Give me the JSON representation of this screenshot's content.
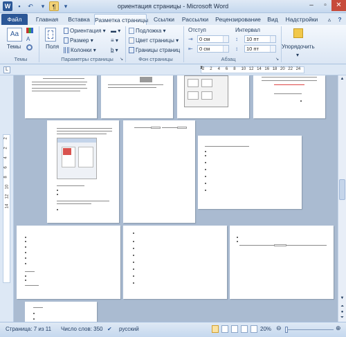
{
  "window": {
    "title": "ориентация страницы - Microsoft Word"
  },
  "tabs": [
    "Файл",
    "Главная",
    "Вставка",
    "Разметка страницы",
    "Ссылки",
    "Рассылки",
    "Рецензирование",
    "Вид",
    "Надстройки"
  ],
  "ribbon": {
    "themes": {
      "label": "Темы",
      "group": "Темы"
    },
    "page_setup": {
      "fields": "Поля",
      "orientation": "Ориентация",
      "size": "Размер",
      "columns": "Колонки",
      "group": "Параметры страницы"
    },
    "background": {
      "watermark": "Подложка",
      "page_color": "Цвет страницы",
      "borders": "Границы страниц",
      "group": "Фон страницы"
    },
    "paragraph": {
      "indent": "Отступ",
      "spacing": "Интервал",
      "left_indent": "0 см",
      "right_indent": "0 см",
      "before": "10 пт",
      "after": "10 пт",
      "group": "Абзац"
    },
    "arrange": {
      "label": "Упорядочить"
    }
  },
  "ruler": {
    "ticks": [
      "2",
      "2",
      "4",
      "6",
      "8",
      "10",
      "12",
      "14",
      "16",
      "18",
      "20",
      "22",
      "24"
    ],
    "vticks": [
      "2",
      "2",
      "4",
      "6",
      "8",
      "10",
      "12",
      "14"
    ]
  },
  "status": {
    "page": "Страница: 7 из 11",
    "words": "Число слов: 350",
    "language": "русский",
    "zoom": "20%"
  },
  "colors": {
    "accent": "#2b5797",
    "workspace": "#aabbd1"
  }
}
